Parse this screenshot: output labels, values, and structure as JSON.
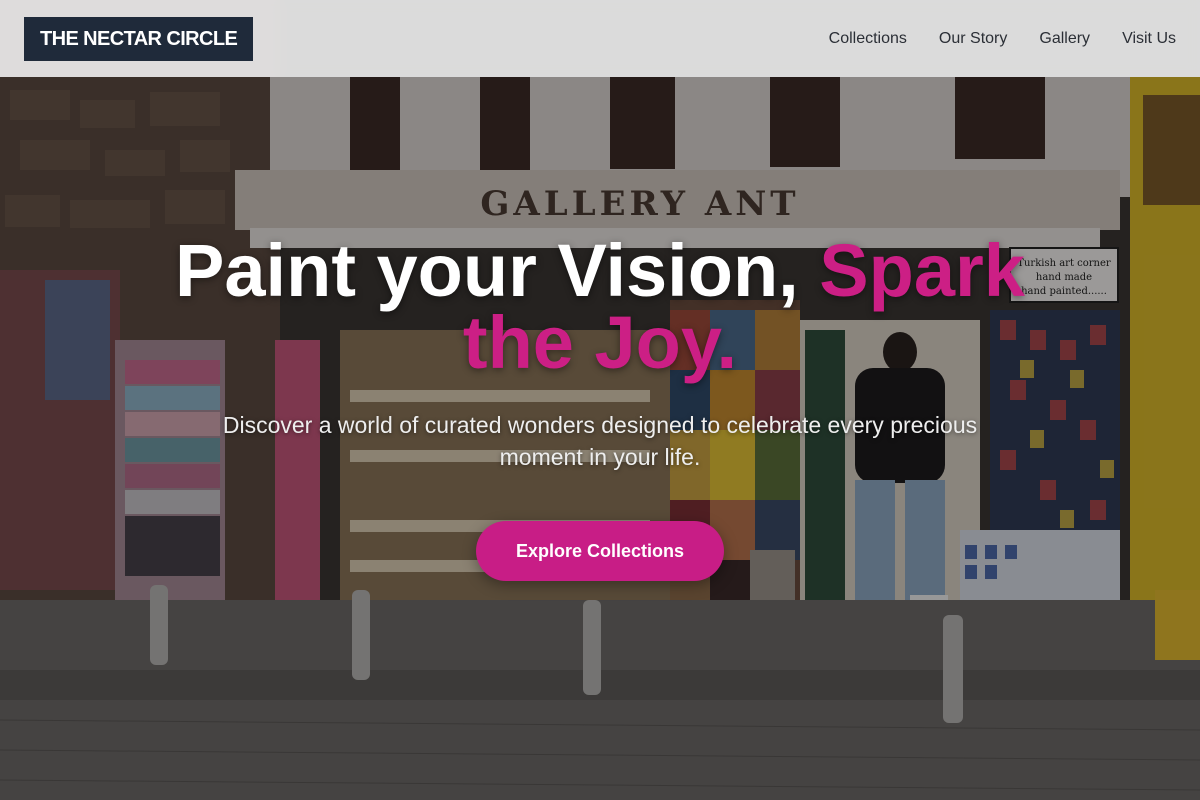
{
  "brand": {
    "name": "THE NECTAR CIRCLE"
  },
  "nav": {
    "items": [
      {
        "label": "Collections"
      },
      {
        "label": "Our Story"
      },
      {
        "label": "Gallery"
      },
      {
        "label": "Visit Us"
      }
    ]
  },
  "hero": {
    "title_main": "Paint your Vision, ",
    "title_accent": "Spark the Joy.",
    "subtitle": "Discover a world of curated wonders designed to celebrate every precious moment in your life.",
    "cta_label": "Explore Collections"
  },
  "background": {
    "shop_sign": "GALLERY ANT",
    "side_sign_lines": [
      "Turkish art corner",
      "hand made",
      "hand painted......"
    ]
  },
  "colors": {
    "accent": "#cc1f85",
    "button": "#c81d86",
    "logo_bg": "#1f2a3a",
    "header_bg": "#f5f5f5"
  }
}
